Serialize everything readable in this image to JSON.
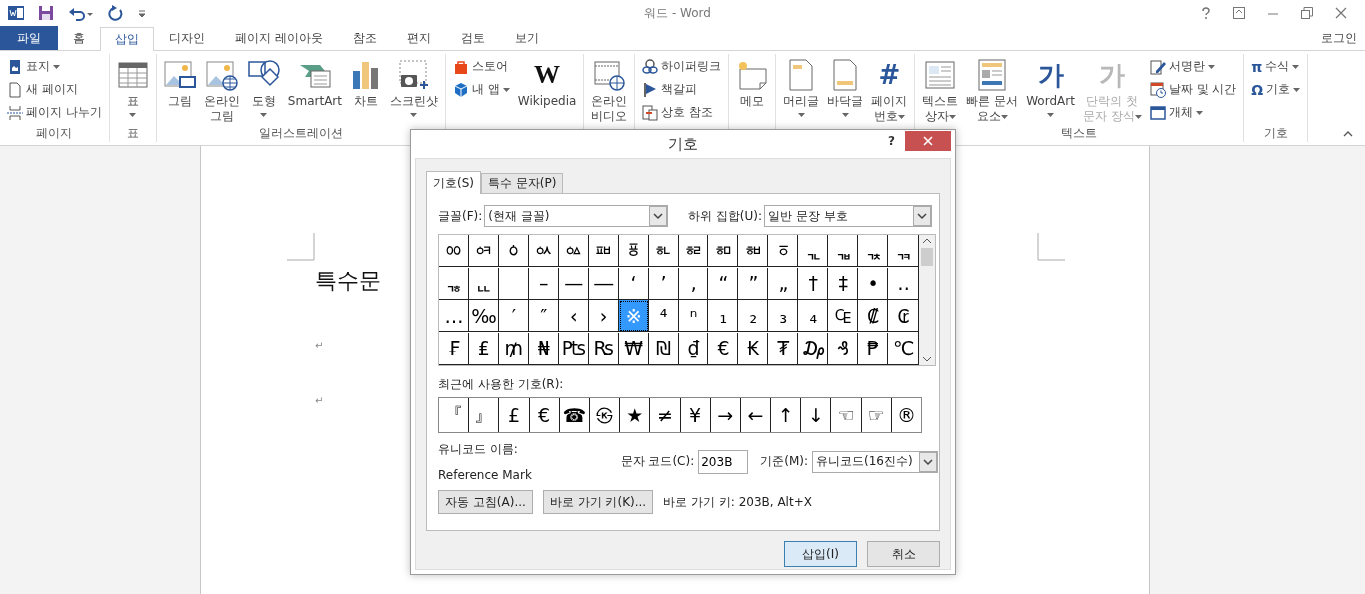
{
  "title_bar": {
    "title": "워드 - Word"
  },
  "tabs": [
    {
      "label": "파일",
      "kind": "file",
      "selected": false
    },
    {
      "label": "홈",
      "kind": "tab",
      "selected": false
    },
    {
      "label": "삽입",
      "kind": "tab",
      "selected": true
    },
    {
      "label": "디자인",
      "kind": "tab",
      "selected": false
    },
    {
      "label": "페이지 레이아웃",
      "kind": "tab",
      "selected": false
    },
    {
      "label": "참조",
      "kind": "tab",
      "selected": false
    },
    {
      "label": "편지",
      "kind": "tab",
      "selected": false
    },
    {
      "label": "검토",
      "kind": "tab",
      "selected": false
    },
    {
      "label": "보기",
      "kind": "tab",
      "selected": false
    }
  ],
  "account": "로그인",
  "ribbon_groups": [
    {
      "label": "페이지",
      "items": [
        {
          "kind": "stack",
          "items": [
            {
              "label": "표지",
              "dropdown": true,
              "disabled": false
            },
            {
              "label": "새 페이지",
              "dropdown": false,
              "disabled": false
            },
            {
              "label": "페이지 나누기",
              "dropdown": false,
              "disabled": false
            }
          ]
        }
      ]
    },
    {
      "label": "표",
      "items": [
        {
          "kind": "large",
          "label": "표",
          "dropdown": true,
          "disabled": false
        }
      ]
    },
    {
      "label": "일러스트레이션",
      "items": [
        {
          "kind": "large",
          "label": "그림",
          "dropdown": false,
          "disabled": false
        },
        {
          "kind": "large",
          "label": "온라인\n그림",
          "dropdown": false,
          "disabled": false
        },
        {
          "kind": "large",
          "label": "도형",
          "dropdown": true,
          "disabled": false
        },
        {
          "kind": "large",
          "label": "SmartArt",
          "dropdown": false,
          "disabled": false
        },
        {
          "kind": "large",
          "label": "차트",
          "dropdown": false,
          "disabled": false
        },
        {
          "kind": "large",
          "label": "스크린샷",
          "dropdown": true,
          "disabled": false
        }
      ]
    },
    {
      "items": [
        {
          "kind": "stack",
          "items": [
            {
              "label": "스토어",
              "dropdown": false,
              "disabled": false
            },
            {
              "label": "내 앱",
              "dropdown": true,
              "disabled": false
            }
          ]
        },
        {
          "kind": "large",
          "label": "Wikipedia",
          "glyph": "W",
          "dropdown": false,
          "disabled": false
        }
      ]
    },
    {
      "items": [
        {
          "kind": "large",
          "label": "온라인\n비디오",
          "dropdown": false,
          "disabled": false
        }
      ]
    },
    {
      "items": [
        {
          "kind": "stack",
          "items": [
            {
              "label": "하이퍼링크",
              "dropdown": false,
              "disabled": false
            },
            {
              "label": "책갈피",
              "dropdown": false,
              "disabled": false
            },
            {
              "label": "상호 참조",
              "dropdown": false,
              "disabled": false
            }
          ]
        }
      ]
    },
    {
      "items": [
        {
          "kind": "large",
          "label": "메모",
          "dropdown": false,
          "disabled": false
        }
      ]
    },
    {
      "items": [
        {
          "kind": "large",
          "label": "머리글",
          "dropdown": true,
          "disabled": false
        },
        {
          "kind": "large",
          "label": "바닥글",
          "dropdown": true,
          "disabled": false
        },
        {
          "kind": "large",
          "label": "페이지\n번호",
          "glyph": "#",
          "dropdown": true,
          "disabled": false
        }
      ]
    },
    {
      "label": "텍스트",
      "items": [
        {
          "kind": "large",
          "label": "텍스트\n상자",
          "dropdown": true,
          "disabled": false
        },
        {
          "kind": "large",
          "label": "빠른 문서\n요소",
          "dropdown": true,
          "disabled": false
        },
        {
          "kind": "large",
          "label": "WordArt",
          "glyph": "가",
          "dropdown": true,
          "disabled": false
        },
        {
          "kind": "large",
          "label": "단락의 첫\n문자 장식",
          "glyph": "가",
          "dropdown": true,
          "disabled": true
        },
        {
          "kind": "stack",
          "items": [
            {
              "label": "서명란",
              "dropdown": true,
              "disabled": false
            },
            {
              "label": "날짜 및 시간",
              "dropdown": false,
              "disabled": false
            },
            {
              "label": "개체",
              "dropdown": true,
              "disabled": false
            }
          ]
        }
      ]
    },
    {
      "label": "기호",
      "items": [
        {
          "kind": "stack",
          "items": [
            {
              "label": "수식",
              "glyph": "π",
              "dropdown": true,
              "disabled": false
            },
            {
              "label": "기호",
              "glyph": "Ω",
              "dropdown": true,
              "disabled": false
            }
          ]
        }
      ]
    }
  ],
  "document": {
    "heading": "특수문",
    "paragraph_marks": [
      "↵",
      "↵"
    ]
  },
  "dialog": {
    "title": "기호",
    "help": "?",
    "tabs": [
      {
        "label": "기호(S)",
        "selected": true
      },
      {
        "label": "특수 문자(P)",
        "selected": false
      }
    ],
    "font": {
      "label": "글꼴(F):",
      "value": "(현재 글꼴)"
    },
    "subset": {
      "label": "하위 집합(U):",
      "value": "일반 문장 부호"
    },
    "symbols": [
      [
        {
          "char": "ᇮ",
          "selected": false
        },
        {
          "char": "ᇯ",
          "selected": false
        },
        {
          "char": "ᇰ",
          "selected": false
        },
        {
          "char": "ᇱ",
          "selected": false
        },
        {
          "char": "ᇲ",
          "selected": false
        },
        {
          "char": "ᇳ",
          "selected": false
        },
        {
          "char": "ᇴ",
          "selected": false
        },
        {
          "char": "ᇵ",
          "selected": false
        },
        {
          "char": "ᇶ",
          "selected": false
        },
        {
          "char": "ᇷ",
          "selected": false
        },
        {
          "char": "ᇸ",
          "selected": false
        },
        {
          "char": "ᇹ",
          "selected": false
        },
        {
          "char": "ᇺ",
          "selected": false
        },
        {
          "char": "ᇻ",
          "selected": false
        },
        {
          "char": "ᇼ",
          "selected": false
        },
        {
          "char": "ᇽ",
          "selected": false
        }
      ],
      [
        {
          "char": "ᇾ",
          "selected": false
        },
        {
          "char": "ᇿ",
          "selected": false
        },
        {
          "selected": false
        },
        {
          "char": "–",
          "selected": false
        },
        {
          "char": "—",
          "selected": false
        },
        {
          "char": "―",
          "selected": false
        },
        {
          "char": "‘",
          "selected": false
        },
        {
          "char": "’",
          "selected": false
        },
        {
          "char": "‚",
          "selected": false
        },
        {
          "char": "“",
          "selected": false
        },
        {
          "char": "”",
          "selected": false
        },
        {
          "char": "„",
          "selected": false
        },
        {
          "char": "†",
          "selected": false
        },
        {
          "char": "‡",
          "selected": false
        },
        {
          "char": "•",
          "selected": false
        },
        {
          "char": "‥",
          "selected": false
        }
      ],
      [
        {
          "char": "…",
          "selected": false
        },
        {
          "char": "‰",
          "selected": false
        },
        {
          "char": "′",
          "selected": false
        },
        {
          "char": "″",
          "selected": false
        },
        {
          "char": "‹",
          "selected": false
        },
        {
          "char": "›",
          "selected": false
        },
        {
          "char": "※",
          "selected": true
        },
        {
          "char": "⁴",
          "selected": false
        },
        {
          "char": "ⁿ",
          "selected": false
        },
        {
          "char": "₁",
          "selected": false
        },
        {
          "char": "₂",
          "selected": false
        },
        {
          "char": "₃",
          "selected": false
        },
        {
          "char": "₄",
          "selected": false
        },
        {
          "char": "₠",
          "selected": false
        },
        {
          "char": "₡",
          "selected": false
        },
        {
          "char": "₢",
          "selected": false
        }
      ],
      [
        {
          "char": "₣",
          "selected": false
        },
        {
          "char": "₤",
          "selected": false
        },
        {
          "char": "₥",
          "selected": false
        },
        {
          "char": "₦",
          "selected": false
        },
        {
          "char": "₧",
          "selected": false
        },
        {
          "char": "₨",
          "selected": false
        },
        {
          "char": "₩",
          "selected": false
        },
        {
          "char": "₪",
          "selected": false
        },
        {
          "char": "₫",
          "selected": false
        },
        {
          "char": "€",
          "selected": false
        },
        {
          "char": "₭",
          "selected": false
        },
        {
          "char": "₮",
          "selected": false
        },
        {
          "char": "₯",
          "selected": false
        },
        {
          "char": "₰",
          "selected": false
        },
        {
          "char": "₱",
          "selected": false
        },
        {
          "char": "℃",
          "selected": false
        }
      ]
    ],
    "recent_label": "최근에 사용한 기호(R):",
    "recent": [
      "『",
      "』",
      "£",
      "€",
      "☎",
      "㉿",
      "★",
      "≠",
      "¥",
      "→",
      "←",
      "↑",
      "↓",
      "☜",
      "☞",
      "®"
    ],
    "unicode_name_label": "유니코드 이름:",
    "unicode_name": "Reference Mark",
    "char_code": {
      "label": "문자 코드(C):",
      "value": "203B"
    },
    "from": {
      "label": "기준(M):",
      "value": "유니코드(16진수)"
    },
    "autocorrect_button": "자동 고침(A)...",
    "shortcut_button": "바로 가기 키(K)...",
    "shortcut_text": "바로 가기 키: 203B, Alt+X",
    "buttons": [
      {
        "label": "삽입(I)",
        "default": true
      },
      {
        "label": "취소",
        "default": false
      }
    ]
  }
}
